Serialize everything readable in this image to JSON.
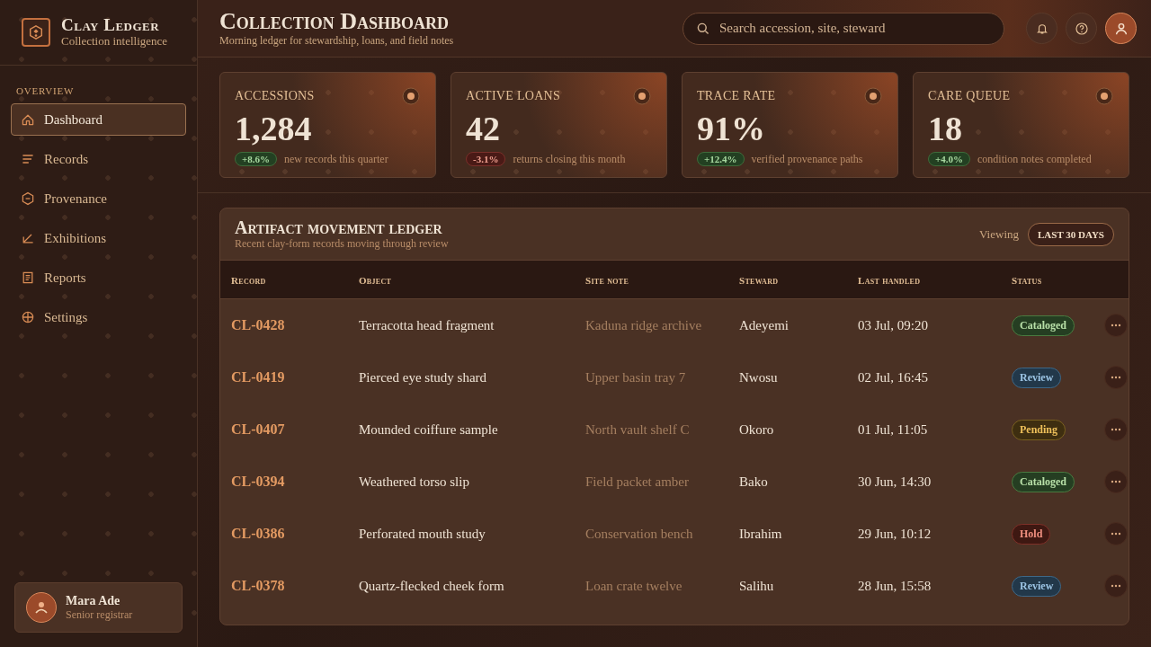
{
  "brand": {
    "name": "Clay Ledger",
    "tagline": "Collection intelligence"
  },
  "sidebar": {
    "section": "OVERVIEW",
    "items": [
      {
        "label": "Dashboard",
        "selected": true
      },
      {
        "label": "Records",
        "selected": false
      },
      {
        "label": "Provenance",
        "selected": false
      },
      {
        "label": "Exhibitions",
        "selected": false
      },
      {
        "label": "Reports",
        "selected": false
      },
      {
        "label": "Settings",
        "selected": false
      }
    ]
  },
  "user": {
    "name": "Mara Ade",
    "role": "Senior registrar"
  },
  "header": {
    "title": "Collection Dashboard",
    "subtitle": "Morning ledger for stewardship, loans, and field notes",
    "search": {
      "placeholder": "Search accession, site, steward"
    }
  },
  "stats": [
    {
      "label": "ACCESSIONS",
      "value": "1,284",
      "delta": "+8.6%",
      "kind": "up",
      "note": "new records this quarter"
    },
    {
      "label": "ACTIVE LOANS",
      "value": "42",
      "delta": "-3.1%",
      "kind": "down",
      "note": "returns closing this month"
    },
    {
      "label": "TRACE RATE",
      "value": "91%",
      "delta": "+12.4%",
      "kind": "up",
      "note": "verified provenance paths"
    },
    {
      "label": "CARE QUEUE",
      "value": "18",
      "delta": "+4.0%",
      "kind": "up",
      "note": "condition notes completed"
    }
  ],
  "ledger": {
    "title": "Artifact movement ledger",
    "subtitle": "Recent clay-form records moving through review",
    "viewing_label": "Viewing",
    "range": "LAST 30 DAYS",
    "columns": [
      "Record",
      "Object",
      "Site note",
      "Steward",
      "Last handled",
      "Status"
    ],
    "rows": [
      {
        "record": "CL-0428",
        "object": "Terracotta head fragment",
        "site": "Kaduna ridge archive",
        "steward": "Adeyemi",
        "handled": "03 Jul, 09:20",
        "status": "Cataloged",
        "kind": "cataloged"
      },
      {
        "record": "CL-0419",
        "object": "Pierced eye study shard",
        "site": "Upper basin tray 7",
        "steward": "Nwosu",
        "handled": "02 Jul, 16:45",
        "status": "Review",
        "kind": "review"
      },
      {
        "record": "CL-0407",
        "object": "Mounded coiffure sample",
        "site": "North vault shelf C",
        "steward": "Okoro",
        "handled": "01 Jul, 11:05",
        "status": "Pending",
        "kind": "pending"
      },
      {
        "record": "CL-0394",
        "object": "Weathered torso slip",
        "site": "Field packet amber",
        "steward": "Bako",
        "handled": "30 Jun, 14:30",
        "status": "Cataloged",
        "kind": "cataloged"
      },
      {
        "record": "CL-0386",
        "object": "Perforated mouth study",
        "site": "Conservation bench",
        "steward": "Ibrahim",
        "handled": "29 Jun, 10:12",
        "status": "Hold",
        "kind": "hold"
      },
      {
        "record": "CL-0378",
        "object": "Quartz-flecked cheek form",
        "site": "Loan crate twelve",
        "steward": "Salihu",
        "handled": "28 Jun, 15:58",
        "status": "Review",
        "kind": "review"
      }
    ]
  }
}
